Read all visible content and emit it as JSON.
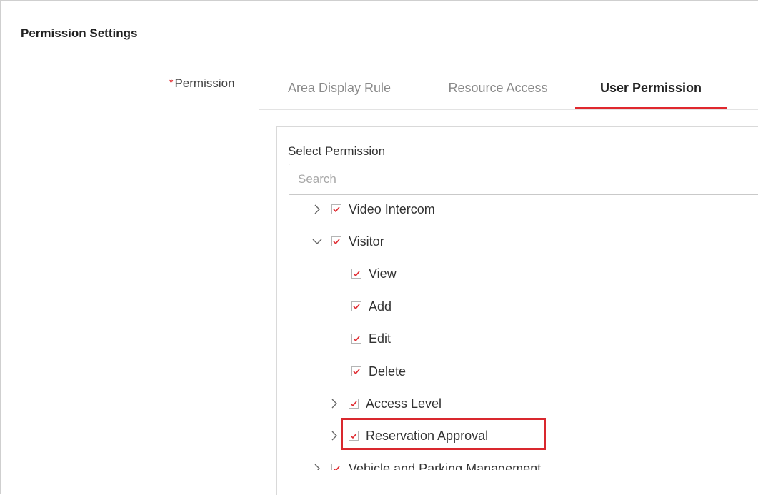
{
  "section": {
    "title": "Permission Settings"
  },
  "permission": {
    "required_mark": "*",
    "label": "Permission"
  },
  "tabs": [
    {
      "label": "Area Display Rule",
      "active": false
    },
    {
      "label": "Resource Access",
      "active": false
    },
    {
      "label": "User Permission",
      "active": true
    }
  ],
  "panel": {
    "select_label": "Select Permission",
    "search_placeholder": "Search",
    "search_value": ""
  },
  "tree": [
    {
      "label": "Video Intercom",
      "expander": "collapsed",
      "checked": true,
      "depth": 0
    },
    {
      "label": "Visitor",
      "expander": "expanded",
      "checked": true,
      "depth": 0
    },
    {
      "label": "View",
      "expander": "none",
      "checked": true,
      "depth": 1
    },
    {
      "label": "Add",
      "expander": "none",
      "checked": true,
      "depth": 1
    },
    {
      "label": "Edit",
      "expander": "none",
      "checked": true,
      "depth": 1
    },
    {
      "label": "Delete",
      "expander": "none",
      "checked": true,
      "depth": 1
    },
    {
      "label": "Access Level",
      "expander": "collapsed",
      "checked": true,
      "depth": 1
    },
    {
      "label": "Reservation Approval",
      "expander": "collapsed",
      "checked": true,
      "depth": 1,
      "highlighted": true
    },
    {
      "label": "Vehicle and Parking Management",
      "expander": "collapsed",
      "checked": true,
      "depth": 0
    }
  ],
  "colors": {
    "accent": "#e0282e",
    "checkmark": "#e0282e",
    "highlight_box": "#d9282e"
  },
  "icons": {
    "collapsed": "chevron-right-icon",
    "expanded": "chevron-down-icon",
    "checkbox": "checked-checkbox-icon"
  }
}
